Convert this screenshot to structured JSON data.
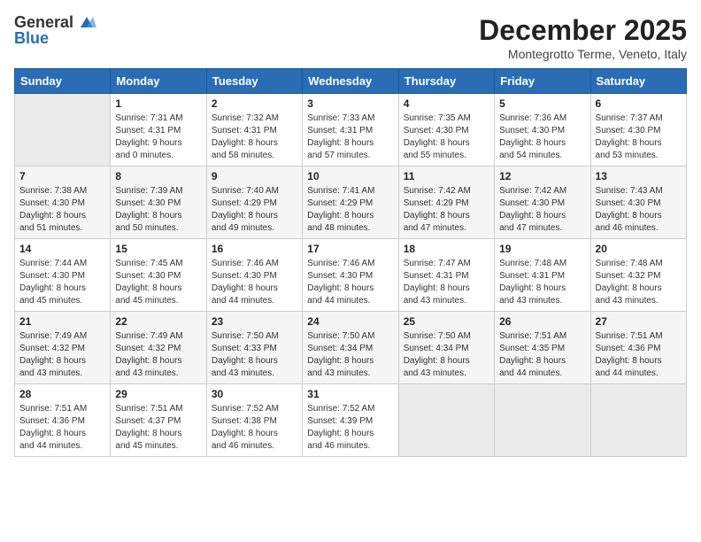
{
  "logo": {
    "general": "General",
    "blue": "Blue"
  },
  "header": {
    "month": "December 2025",
    "location": "Montegrotto Terme, Veneto, Italy"
  },
  "weekdays": [
    "Sunday",
    "Monday",
    "Tuesday",
    "Wednesday",
    "Thursday",
    "Friday",
    "Saturday"
  ],
  "weeks": [
    [
      {
        "day": "",
        "info": ""
      },
      {
        "day": "1",
        "info": "Sunrise: 7:31 AM\nSunset: 4:31 PM\nDaylight: 9 hours\nand 0 minutes."
      },
      {
        "day": "2",
        "info": "Sunrise: 7:32 AM\nSunset: 4:31 PM\nDaylight: 8 hours\nand 58 minutes."
      },
      {
        "day": "3",
        "info": "Sunrise: 7:33 AM\nSunset: 4:31 PM\nDaylight: 8 hours\nand 57 minutes."
      },
      {
        "day": "4",
        "info": "Sunrise: 7:35 AM\nSunset: 4:30 PM\nDaylight: 8 hours\nand 55 minutes."
      },
      {
        "day": "5",
        "info": "Sunrise: 7:36 AM\nSunset: 4:30 PM\nDaylight: 8 hours\nand 54 minutes."
      },
      {
        "day": "6",
        "info": "Sunrise: 7:37 AM\nSunset: 4:30 PM\nDaylight: 8 hours\nand 53 minutes."
      }
    ],
    [
      {
        "day": "7",
        "info": "Sunrise: 7:38 AM\nSunset: 4:30 PM\nDaylight: 8 hours\nand 51 minutes."
      },
      {
        "day": "8",
        "info": "Sunrise: 7:39 AM\nSunset: 4:30 PM\nDaylight: 8 hours\nand 50 minutes."
      },
      {
        "day": "9",
        "info": "Sunrise: 7:40 AM\nSunset: 4:29 PM\nDaylight: 8 hours\nand 49 minutes."
      },
      {
        "day": "10",
        "info": "Sunrise: 7:41 AM\nSunset: 4:29 PM\nDaylight: 8 hours\nand 48 minutes."
      },
      {
        "day": "11",
        "info": "Sunrise: 7:42 AM\nSunset: 4:29 PM\nDaylight: 8 hours\nand 47 minutes."
      },
      {
        "day": "12",
        "info": "Sunrise: 7:42 AM\nSunset: 4:30 PM\nDaylight: 8 hours\nand 47 minutes."
      },
      {
        "day": "13",
        "info": "Sunrise: 7:43 AM\nSunset: 4:30 PM\nDaylight: 8 hours\nand 46 minutes."
      }
    ],
    [
      {
        "day": "14",
        "info": "Sunrise: 7:44 AM\nSunset: 4:30 PM\nDaylight: 8 hours\nand 45 minutes."
      },
      {
        "day": "15",
        "info": "Sunrise: 7:45 AM\nSunset: 4:30 PM\nDaylight: 8 hours\nand 45 minutes."
      },
      {
        "day": "16",
        "info": "Sunrise: 7:46 AM\nSunset: 4:30 PM\nDaylight: 8 hours\nand 44 minutes."
      },
      {
        "day": "17",
        "info": "Sunrise: 7:46 AM\nSunset: 4:30 PM\nDaylight: 8 hours\nand 44 minutes."
      },
      {
        "day": "18",
        "info": "Sunrise: 7:47 AM\nSunset: 4:31 PM\nDaylight: 8 hours\nand 43 minutes."
      },
      {
        "day": "19",
        "info": "Sunrise: 7:48 AM\nSunset: 4:31 PM\nDaylight: 8 hours\nand 43 minutes."
      },
      {
        "day": "20",
        "info": "Sunrise: 7:48 AM\nSunset: 4:32 PM\nDaylight: 8 hours\nand 43 minutes."
      }
    ],
    [
      {
        "day": "21",
        "info": "Sunrise: 7:49 AM\nSunset: 4:32 PM\nDaylight: 8 hours\nand 43 minutes."
      },
      {
        "day": "22",
        "info": "Sunrise: 7:49 AM\nSunset: 4:32 PM\nDaylight: 8 hours\nand 43 minutes."
      },
      {
        "day": "23",
        "info": "Sunrise: 7:50 AM\nSunset: 4:33 PM\nDaylight: 8 hours\nand 43 minutes."
      },
      {
        "day": "24",
        "info": "Sunrise: 7:50 AM\nSunset: 4:34 PM\nDaylight: 8 hours\nand 43 minutes."
      },
      {
        "day": "25",
        "info": "Sunrise: 7:50 AM\nSunset: 4:34 PM\nDaylight: 8 hours\nand 43 minutes."
      },
      {
        "day": "26",
        "info": "Sunrise: 7:51 AM\nSunset: 4:35 PM\nDaylight: 8 hours\nand 44 minutes."
      },
      {
        "day": "27",
        "info": "Sunrise: 7:51 AM\nSunset: 4:36 PM\nDaylight: 8 hours\nand 44 minutes."
      }
    ],
    [
      {
        "day": "28",
        "info": "Sunrise: 7:51 AM\nSunset: 4:36 PM\nDaylight: 8 hours\nand 44 minutes."
      },
      {
        "day": "29",
        "info": "Sunrise: 7:51 AM\nSunset: 4:37 PM\nDaylight: 8 hours\nand 45 minutes."
      },
      {
        "day": "30",
        "info": "Sunrise: 7:52 AM\nSunset: 4:38 PM\nDaylight: 8 hours\nand 46 minutes."
      },
      {
        "day": "31",
        "info": "Sunrise: 7:52 AM\nSunset: 4:39 PM\nDaylight: 8 hours\nand 46 minutes."
      },
      {
        "day": "",
        "info": ""
      },
      {
        "day": "",
        "info": ""
      },
      {
        "day": "",
        "info": ""
      }
    ]
  ]
}
